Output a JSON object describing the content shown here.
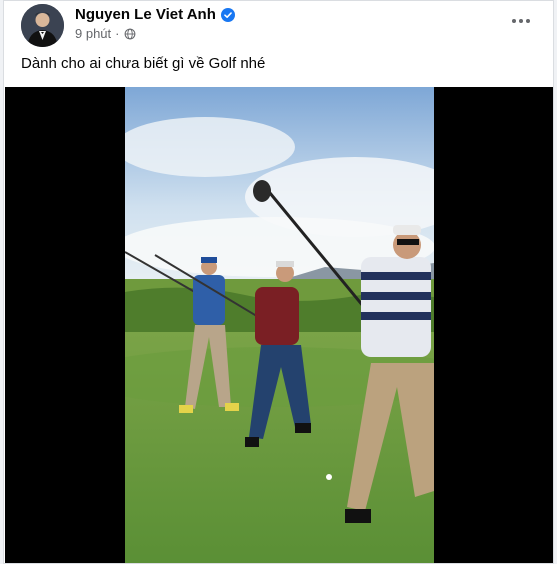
{
  "post": {
    "author": "Nguyen Le Viet Anh",
    "time": "9 phút",
    "separator": "·",
    "caption": "Dành cho ai chưa biết gì về Golf nhé"
  },
  "icons": {
    "verified": "verified-badge-icon",
    "audience": "globe-icon",
    "more": "more-options-icon"
  },
  "colors": {
    "verified_blue": "#1877f2",
    "meta_gray": "#65676b",
    "text": "#050505"
  }
}
